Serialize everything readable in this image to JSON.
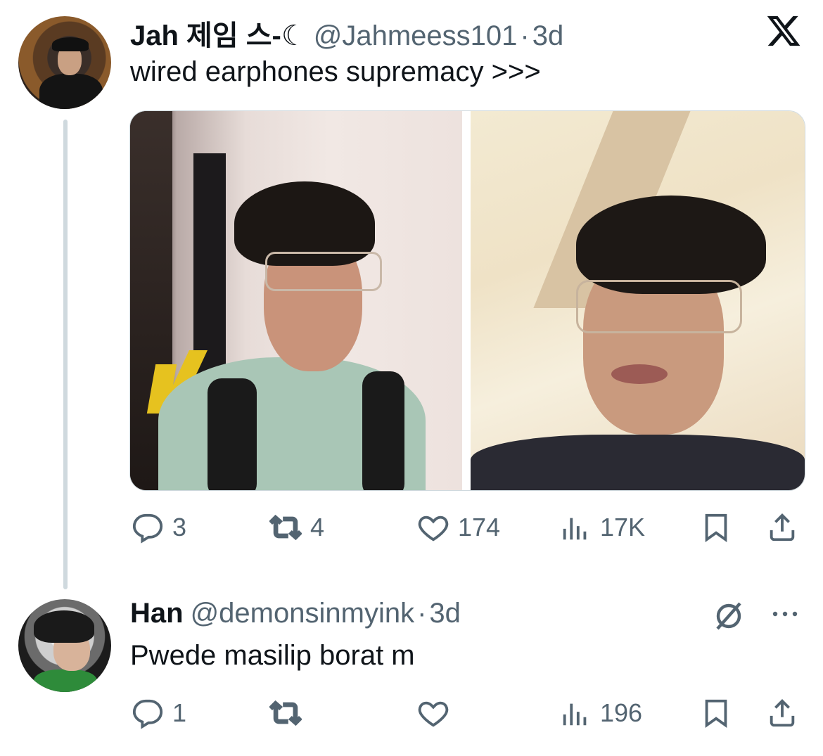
{
  "tweet": {
    "author": {
      "name": "Jah 제임 스-☾",
      "handle": "@Jahmeess101",
      "time": "3d",
      "avatar_icon": "profile-photo"
    },
    "text": "wired earphones supremacy >>>",
    "media": [
      {
        "type": "photo",
        "icon": "selfie-photo-left"
      },
      {
        "type": "photo",
        "icon": "selfie-photo-right"
      }
    ],
    "stats": {
      "replies": "3",
      "reposts": "4",
      "likes": "174",
      "views": "17K"
    }
  },
  "reply": {
    "author": {
      "name": "Han",
      "handle": "@demonsinmyink",
      "time": "3d",
      "avatar_icon": "profile-photo"
    },
    "text": "Pwede masilip borat m",
    "stats": {
      "replies": "1",
      "reposts": "",
      "likes": "",
      "views": "196"
    }
  },
  "separator": "·",
  "colors": {
    "text_primary": "#0f1419",
    "text_secondary": "#536471",
    "thread_line": "#cfd9de"
  },
  "icons": [
    "x-logo-icon",
    "reply-icon",
    "repost-icon",
    "like-icon",
    "views-icon",
    "bookmark-icon",
    "share-icon",
    "grok-icon",
    "more-icon"
  ]
}
